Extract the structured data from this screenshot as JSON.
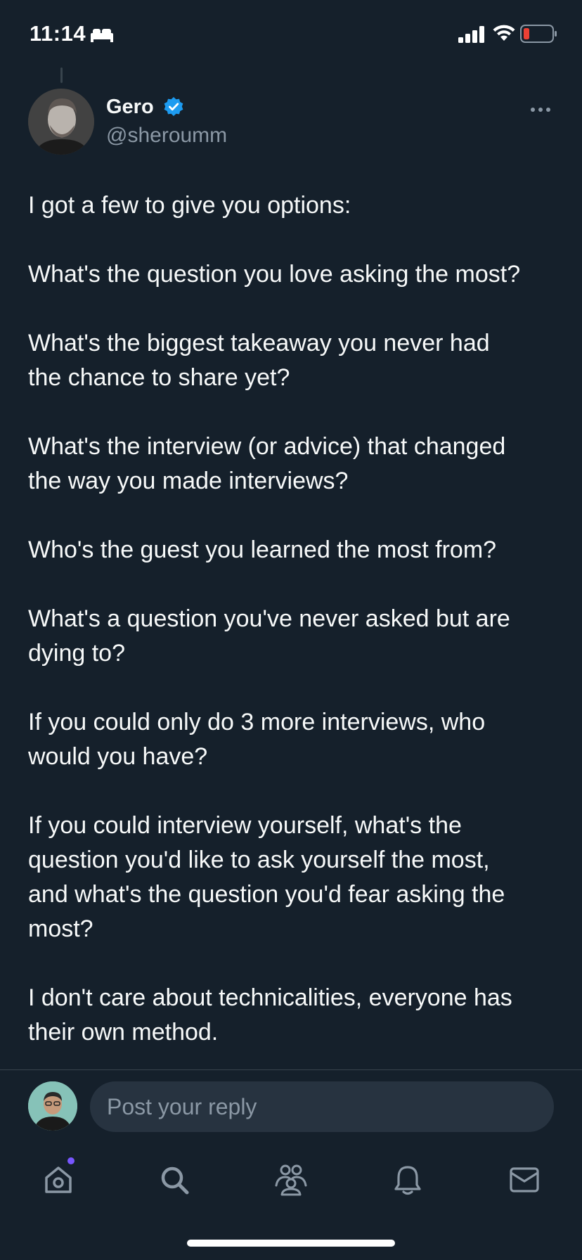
{
  "status_bar": {
    "time": "11:14",
    "sleep_icon": "bed-icon",
    "signal_icon": "cellular-signal-icon",
    "wifi_icon": "wifi-icon",
    "battery_icon": "battery-low-icon",
    "battery_color": "#eb4034"
  },
  "post": {
    "author": {
      "name": "Gero",
      "handle": "@sheroumm",
      "verified": true,
      "verified_color": "#1d9bf0"
    },
    "more_icon": "more-horizontal-icon",
    "paragraphs": [
      "I got a few to give you options:",
      "What's the question you love asking the most?",
      "What's the biggest takeaway you never had\nthe chance to share yet?",
      "What's the interview (or advice) that changed\nthe way you made interviews?",
      "Who's the guest you learned the most from?",
      "What's a question you've never asked but are\ndying to?",
      "If you could only do 3 more interviews, who\nwould you have?",
      "If you could interview yourself, what's the\nquestion you'd like to ask yourself the most,\nand what's the question you'd fear asking the\nmost?",
      "I don't care about technicalities, everyone has\ntheir own method."
    ]
  },
  "reply": {
    "placeholder": "Post your reply"
  },
  "tab_bar": {
    "items": [
      {
        "name": "home",
        "icon": "home-icon",
        "has_notification_dot": true
      },
      {
        "name": "search",
        "icon": "search-icon"
      },
      {
        "name": "communities",
        "icon": "communities-icon"
      },
      {
        "name": "notifications",
        "icon": "bell-icon"
      },
      {
        "name": "messages",
        "icon": "mail-icon"
      }
    ],
    "notification_dot_color": "#7856ff"
  },
  "colors": {
    "background": "#15202b",
    "text": "#f7f9f9",
    "secondary_text": "#8b98a5",
    "accent": "#1d9bf0"
  }
}
